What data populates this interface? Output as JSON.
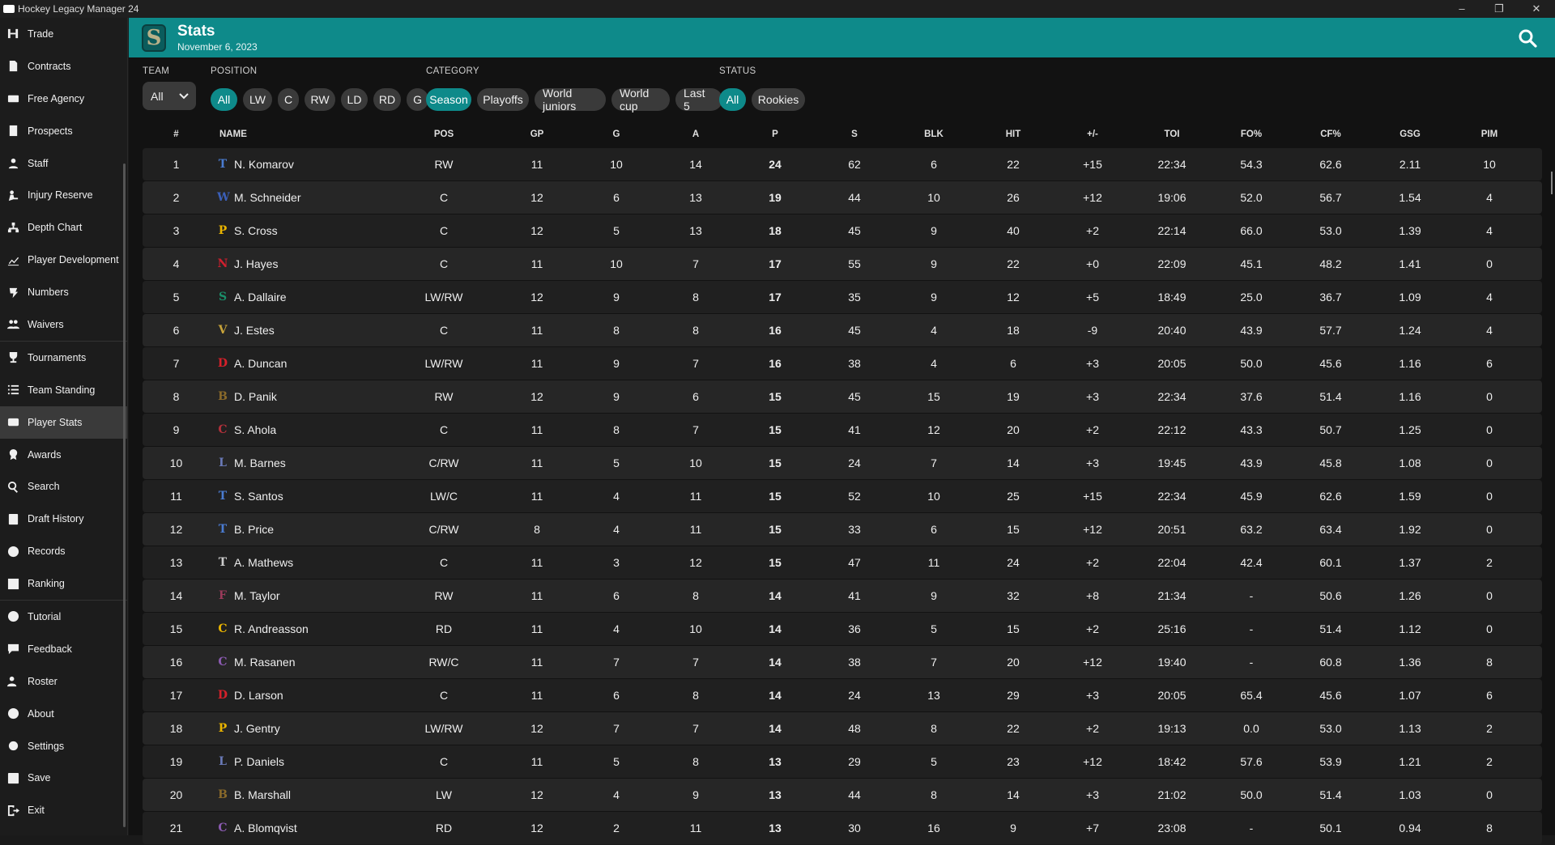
{
  "window": {
    "title": "Hockey Legacy Manager 24",
    "controls": [
      "–",
      "❐",
      "✕"
    ]
  },
  "sidebar": {
    "items": [
      {
        "label": "Trade",
        "icon": "trade-icon"
      },
      {
        "label": "Contracts",
        "icon": "contracts-icon"
      },
      {
        "label": "Free Agency",
        "icon": "free-agency-icon"
      },
      {
        "label": "Prospects",
        "icon": "prospects-icon"
      },
      {
        "label": "Staff",
        "icon": "staff-icon"
      },
      {
        "label": "Injury Reserve",
        "icon": "injury-icon"
      },
      {
        "label": "Depth Chart",
        "icon": "depth-chart-icon"
      },
      {
        "label": "Player Development",
        "icon": "development-icon"
      },
      {
        "label": "Numbers",
        "icon": "numbers-icon"
      },
      {
        "label": "Waivers",
        "icon": "waivers-icon"
      },
      {
        "label": "Tournaments",
        "icon": "trophy-icon"
      },
      {
        "label": "Team Standing",
        "icon": "list-icon"
      },
      {
        "label": "Player Stats",
        "icon": "stats-icon",
        "active": true
      },
      {
        "label": "Awards",
        "icon": "awards-icon"
      },
      {
        "label": "Search",
        "icon": "search-icon"
      },
      {
        "label": "Draft History",
        "icon": "draft-icon"
      },
      {
        "label": "Records",
        "icon": "records-icon"
      },
      {
        "label": "Ranking",
        "icon": "ranking-icon"
      },
      {
        "label": "Tutorial",
        "icon": "help-icon"
      },
      {
        "label": "Feedback",
        "icon": "feedback-icon"
      },
      {
        "label": "Roster",
        "icon": "roster-icon"
      },
      {
        "label": "About",
        "icon": "info-icon"
      },
      {
        "label": "Settings",
        "icon": "gear-icon"
      },
      {
        "label": "Save",
        "icon": "save-icon"
      },
      {
        "label": "Exit",
        "icon": "exit-icon"
      }
    ]
  },
  "header": {
    "title": "Stats",
    "date": "November 6, 2023",
    "logo_letter": "S"
  },
  "filters": {
    "team_label": "TEAM",
    "team_value": "All",
    "position_label": "POSITION",
    "positions": [
      {
        "label": "All",
        "on": true
      },
      {
        "label": "LW"
      },
      {
        "label": "C"
      },
      {
        "label": "RW"
      },
      {
        "label": "LD"
      },
      {
        "label": "RD"
      },
      {
        "label": "G"
      }
    ],
    "category_label": "CATEGORY",
    "categories": [
      {
        "label": "Season",
        "on": true
      },
      {
        "label": "Playoffs"
      },
      {
        "label": "World juniors"
      },
      {
        "label": "World cup"
      },
      {
        "label": "Last 5"
      }
    ],
    "status_label": "STATUS",
    "statuses": [
      {
        "label": "All",
        "on": true
      },
      {
        "label": "Rookies"
      }
    ]
  },
  "table": {
    "columns": [
      "#",
      "NAME",
      "POS",
      "GP",
      "G",
      "A",
      "P",
      "S",
      "BLK",
      "HIT",
      "+/-",
      "TOI",
      "FO%",
      "CF%",
      "GSG",
      "PIM"
    ],
    "rows": [
      {
        "n": "1",
        "logo": "T",
        "logo_color": "#4a7bd0",
        "name": "N. Komarov",
        "pos": "RW",
        "gp": "11",
        "g": "10",
        "a": "14",
        "p": "24",
        "s": "62",
        "blk": "6",
        "hit": "22",
        "pm": "+15",
        "toi": "22:34",
        "fo": "54.3",
        "cf": "62.6",
        "gsg": "2.11",
        "pim": "10"
      },
      {
        "n": "2",
        "logo": "W",
        "logo_color": "#3b5fb8",
        "name": "M. Schneider",
        "pos": "C",
        "gp": "12",
        "g": "6",
        "a": "13",
        "p": "19",
        "s": "44",
        "blk": "10",
        "hit": "26",
        "pm": "+12",
        "toi": "19:06",
        "fo": "52.0",
        "cf": "56.7",
        "gsg": "1.54",
        "pim": "4"
      },
      {
        "n": "3",
        "logo": "P",
        "logo_color": "#e8b300",
        "name": "S. Cross",
        "pos": "C",
        "gp": "12",
        "g": "5",
        "a": "13",
        "p": "18",
        "s": "45",
        "blk": "9",
        "hit": "40",
        "pm": "+2",
        "toi": "22:14",
        "fo": "66.0",
        "cf": "53.0",
        "gsg": "1.39",
        "pim": "4"
      },
      {
        "n": "4",
        "logo": "N",
        "logo_color": "#d01f2e",
        "name": "J. Hayes",
        "pos": "C",
        "gp": "11",
        "g": "10",
        "a": "7",
        "p": "17",
        "s": "55",
        "blk": "9",
        "hit": "22",
        "pm": "+0",
        "toi": "22:09",
        "fo": "45.1",
        "cf": "48.2",
        "gsg": "1.41",
        "pim": "0"
      },
      {
        "n": "5",
        "logo": "S",
        "logo_color": "#1a8f6a",
        "name": "A. Dallaire",
        "pos": "LW/RW",
        "gp": "12",
        "g": "9",
        "a": "8",
        "p": "17",
        "s": "35",
        "blk": "9",
        "hit": "12",
        "pm": "+5",
        "toi": "18:49",
        "fo": "25.0",
        "cf": "36.7",
        "gsg": "1.09",
        "pim": "4"
      },
      {
        "n": "6",
        "logo": "V",
        "logo_color": "#c9a43a",
        "name": "J. Estes",
        "pos": "C",
        "gp": "11",
        "g": "8",
        "a": "8",
        "p": "16",
        "s": "45",
        "blk": "4",
        "hit": "18",
        "pm": "-9",
        "toi": "20:40",
        "fo": "43.9",
        "cf": "57.7",
        "gsg": "1.24",
        "pim": "4"
      },
      {
        "n": "7",
        "logo": "D",
        "logo_color": "#d5202a",
        "name": "A. Duncan",
        "pos": "LW/RW",
        "gp": "11",
        "g": "9",
        "a": "7",
        "p": "16",
        "s": "38",
        "blk": "4",
        "hit": "6",
        "pm": "+3",
        "toi": "20:05",
        "fo": "50.0",
        "cf": "45.6",
        "gsg": "1.16",
        "pim": "6"
      },
      {
        "n": "8",
        "logo": "B",
        "logo_color": "#8a6a2a",
        "name": "D. Panik",
        "pos": "RW",
        "gp": "12",
        "g": "9",
        "a": "6",
        "p": "15",
        "s": "45",
        "blk": "15",
        "hit": "19",
        "pm": "+3",
        "toi": "22:34",
        "fo": "37.6",
        "cf": "51.4",
        "gsg": "1.16",
        "pim": "0"
      },
      {
        "n": "9",
        "logo": "C",
        "logo_color": "#b0303a",
        "name": "S. Ahola",
        "pos": "C",
        "gp": "11",
        "g": "8",
        "a": "7",
        "p": "15",
        "s": "41",
        "blk": "12",
        "hit": "20",
        "pm": "+2",
        "toi": "22:12",
        "fo": "43.3",
        "cf": "50.7",
        "gsg": "1.25",
        "pim": "0"
      },
      {
        "n": "10",
        "logo": "L",
        "logo_color": "#6a7ab8",
        "name": "M. Barnes",
        "pos": "C/RW",
        "gp": "11",
        "g": "5",
        "a": "10",
        "p": "15",
        "s": "24",
        "blk": "7",
        "hit": "14",
        "pm": "+3",
        "toi": "19:45",
        "fo": "43.9",
        "cf": "45.8",
        "gsg": "1.08",
        "pim": "0"
      },
      {
        "n": "11",
        "logo": "T",
        "logo_color": "#4a7bd0",
        "name": "S. Santos",
        "pos": "LW/C",
        "gp": "11",
        "g": "4",
        "a": "11",
        "p": "15",
        "s": "52",
        "blk": "10",
        "hit": "25",
        "pm": "+15",
        "toi": "22:34",
        "fo": "45.9",
        "cf": "62.6",
        "gsg": "1.59",
        "pim": "0"
      },
      {
        "n": "12",
        "logo": "T",
        "logo_color": "#4a7bd0",
        "name": "B. Price",
        "pos": "C/RW",
        "gp": "8",
        "g": "4",
        "a": "11",
        "p": "15",
        "s": "33",
        "blk": "6",
        "hit": "15",
        "pm": "+12",
        "toi": "20:51",
        "fo": "63.2",
        "cf": "63.4",
        "gsg": "1.92",
        "pim": "0"
      },
      {
        "n": "13",
        "logo": "T",
        "logo_color": "#cccccc",
        "name": "A. Mathews",
        "pos": "C",
        "gp": "11",
        "g": "3",
        "a": "12",
        "p": "15",
        "s": "47",
        "blk": "11",
        "hit": "24",
        "pm": "+2",
        "toi": "22:04",
        "fo": "42.4",
        "cf": "60.1",
        "gsg": "1.37",
        "pim": "2"
      },
      {
        "n": "14",
        "logo": "F",
        "logo_color": "#9a3a5a",
        "name": "M. Taylor",
        "pos": "RW",
        "gp": "11",
        "g": "6",
        "a": "8",
        "p": "14",
        "s": "41",
        "blk": "9",
        "hit": "32",
        "pm": "+8",
        "toi": "21:34",
        "fo": "-",
        "cf": "50.6",
        "gsg": "1.26",
        "pim": "0"
      },
      {
        "n": "15",
        "logo": "C",
        "logo_color": "#e8b300",
        "name": "R. Andreasson",
        "pos": "RD",
        "gp": "11",
        "g": "4",
        "a": "10",
        "p": "14",
        "s": "36",
        "blk": "5",
        "hit": "15",
        "pm": "+2",
        "toi": "25:16",
        "fo": "-",
        "cf": "51.4",
        "gsg": "1.12",
        "pim": "0"
      },
      {
        "n": "16",
        "logo": "C",
        "logo_color": "#8a5ab0",
        "name": "M. Rasanen",
        "pos": "RW/C",
        "gp": "11",
        "g": "7",
        "a": "7",
        "p": "14",
        "s": "38",
        "blk": "7",
        "hit": "20",
        "pm": "+12",
        "toi": "19:40",
        "fo": "-",
        "cf": "60.8",
        "gsg": "1.36",
        "pim": "8"
      },
      {
        "n": "17",
        "logo": "D",
        "logo_color": "#d5202a",
        "name": "D. Larson",
        "pos": "C",
        "gp": "11",
        "g": "6",
        "a": "8",
        "p": "14",
        "s": "24",
        "blk": "13",
        "hit": "29",
        "pm": "+3",
        "toi": "20:05",
        "fo": "65.4",
        "cf": "45.6",
        "gsg": "1.07",
        "pim": "6"
      },
      {
        "n": "18",
        "logo": "P",
        "logo_color": "#e8b300",
        "name": "J. Gentry",
        "pos": "LW/RW",
        "gp": "12",
        "g": "7",
        "a": "7",
        "p": "14",
        "s": "48",
        "blk": "8",
        "hit": "22",
        "pm": "+2",
        "toi": "19:13",
        "fo": "0.0",
        "cf": "53.0",
        "gsg": "1.13",
        "pim": "2"
      },
      {
        "n": "19",
        "logo": "L",
        "logo_color": "#6a7ab8",
        "name": "P. Daniels",
        "pos": "C",
        "gp": "11",
        "g": "5",
        "a": "8",
        "p": "13",
        "s": "29",
        "blk": "5",
        "hit": "23",
        "pm": "+12",
        "toi": "18:42",
        "fo": "57.6",
        "cf": "53.9",
        "gsg": "1.21",
        "pim": "2"
      },
      {
        "n": "20",
        "logo": "B",
        "logo_color": "#8a6a2a",
        "name": "B. Marshall",
        "pos": "LW",
        "gp": "12",
        "g": "4",
        "a": "9",
        "p": "13",
        "s": "44",
        "blk": "8",
        "hit": "14",
        "pm": "+3",
        "toi": "21:02",
        "fo": "50.0",
        "cf": "51.4",
        "gsg": "1.03",
        "pim": "0"
      },
      {
        "n": "21",
        "logo": "C",
        "logo_color": "#8a5ab0",
        "name": "A. Blomqvist",
        "pos": "RD",
        "gp": "12",
        "g": "2",
        "a": "11",
        "p": "13",
        "s": "30",
        "blk": "16",
        "hit": "9",
        "pm": "+7",
        "toi": "23:08",
        "fo": "-",
        "cf": "50.1",
        "gsg": "0.94",
        "pim": "8"
      }
    ]
  }
}
